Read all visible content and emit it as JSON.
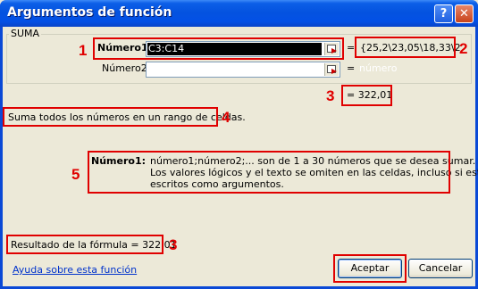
{
  "window": {
    "title": "Argumentos de función",
    "help_button": "?",
    "close_button": "✕",
    "title_color": "#0453df"
  },
  "group": {
    "label": "SUMA",
    "args": [
      {
        "label": "Número1",
        "value": "C3:C14",
        "result": "{25,2\\23,05\\18,33\\2"
      },
      {
        "label": "Número2",
        "value": "",
        "result": "número"
      }
    ],
    "equals": "="
  },
  "result_preview": "= 322,01",
  "description": "Suma todos los números en un rango de celdas.",
  "help": {
    "name": "Número1:",
    "lines": [
      "número1;número2;... son de 1 a 30 números que se desea sumar.",
      "Los valores lógicos y el texto se omiten en las celdas, incluso si están",
      "escritos como argumentos."
    ]
  },
  "formula_result": "Resultado de la fórmula =   322,01",
  "help_link": "Ayuda sobre esta función",
  "buttons": {
    "ok": "Aceptar",
    "cancel": "Cancelar"
  },
  "annotations": {
    "n1": "1",
    "n2": "2",
    "n3a": "3",
    "n4": "4",
    "n5": "5",
    "n3b": "3",
    "color": "#e00000"
  },
  "icons": {
    "collapse": "collapse-dialog-icon"
  }
}
